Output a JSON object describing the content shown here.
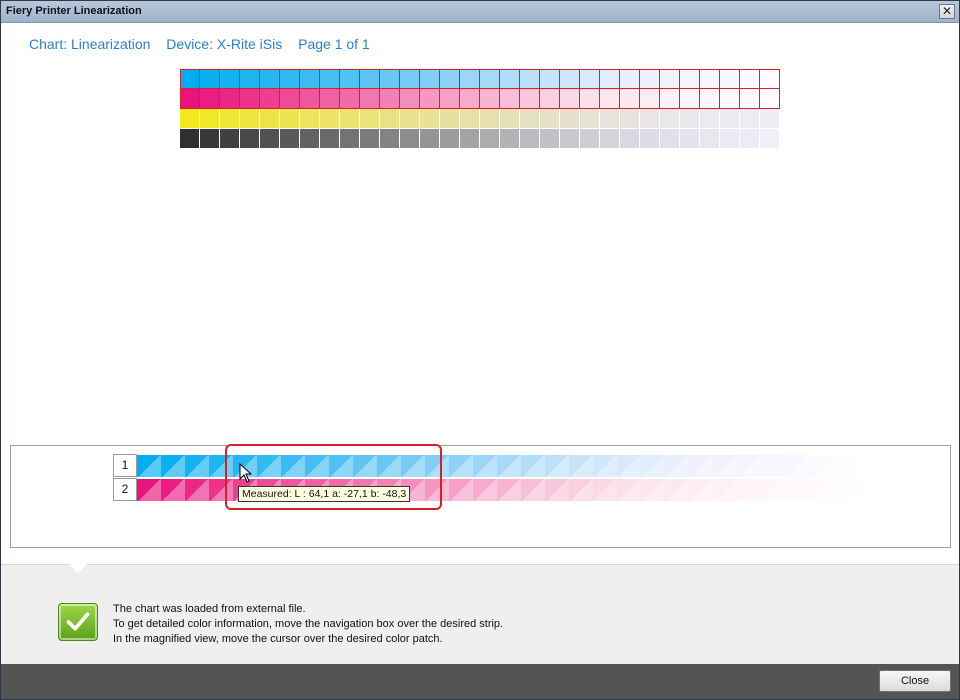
{
  "window": {
    "title": "Fiery Printer Linearization",
    "close_glyph": "✕"
  },
  "header": {
    "chart": "Chart: Linearization",
    "device": "Device: X-Rite iSis",
    "page": "Page 1 of 1"
  },
  "chart": {
    "rows": [
      {
        "name": "cyan",
        "colors": [
          "#00aeef",
          "#0bb0ef",
          "#14b2ef",
          "#1db4f0",
          "#27b6f0",
          "#31b9f1",
          "#3bbbf1",
          "#46bef2",
          "#52c1f3",
          "#5dc4f4",
          "#69c7f4",
          "#76cbf5",
          "#82cef6",
          "#8fd2f7",
          "#9bd5f7",
          "#a7d9f8",
          "#b2dcf9",
          "#bde0f9",
          "#c7e3fa",
          "#d0e6fb",
          "#d9e9fb",
          "#e1ecfc",
          "#e8eefc",
          "#eef0fd",
          "#f2f2fd",
          "#f5f4fd",
          "#f7f5fd",
          "#f9f7fe",
          "#fbf9fe",
          "#fcfbfe"
        ]
      },
      {
        "name": "magenta",
        "colors": [
          "#e8147d",
          "#e91d82",
          "#ea2887",
          "#eb338c",
          "#ec3f92",
          "#ed4a97",
          "#ee569d",
          "#ef61a3",
          "#f06ca9",
          "#f177af",
          "#f282b5",
          "#f38dbb",
          "#f497c1",
          "#f5a1c7",
          "#f6abcc",
          "#f7b5d1",
          "#f8bed6",
          "#f9c7db",
          "#fad0e0",
          "#fad8e5",
          "#fbdfe9",
          "#fce5ed",
          "#fce9f0",
          "#fdedf3",
          "#fdf0f6",
          "#fdf3f8",
          "#fef6fa",
          "#fef8fb",
          "#fefafc",
          "#fffcfd"
        ]
      },
      {
        "name": "yellow",
        "colors": [
          "#f2e81e",
          "#f1e72a",
          "#f0e635",
          "#efe53f",
          "#eee449",
          "#ede453",
          "#ede35d",
          "#ece367",
          "#ebe271",
          "#eae27b",
          "#e9e285",
          "#e9e18e",
          "#e8e197",
          "#e7e1a0",
          "#e7e1a9",
          "#e6e0b1",
          "#e6e0b9",
          "#e5e1c0",
          "#e5e1c7",
          "#e5e1ce",
          "#e6e2d4",
          "#e6e3da",
          "#e7e4df",
          "#e8e5e4",
          "#e9e7e8",
          "#eae8ec",
          "#ebeaef",
          "#ecebf2",
          "#edecf4",
          "#eeeef6"
        ]
      },
      {
        "name": "black",
        "colors": [
          "#2f2f2f",
          "#383838",
          "#404040",
          "#484848",
          "#515151",
          "#595959",
          "#626262",
          "#6a6a6a",
          "#737373",
          "#7b7b7b",
          "#838383",
          "#8c8c8c",
          "#949494",
          "#9c9c9c",
          "#a4a4a4",
          "#acacac",
          "#b3b3b6",
          "#babac0",
          "#c1c1c8",
          "#c7c7cf",
          "#cdcdd6",
          "#d3d3dc",
          "#d8d8e2",
          "#dcdce7",
          "#e0e0eb",
          "#e4e4ef",
          "#e7e7f2",
          "#eaeaf4",
          "#ececf6",
          "#efeff8"
        ]
      }
    ]
  },
  "magnified": {
    "strips": [
      {
        "number": "1",
        "colors": [
          "#00aeef",
          "#0bb0ef",
          "#14b2ef",
          "#1db4f0",
          "#27b6f0",
          "#31b9f1",
          "#3bbbf1",
          "#46bef2",
          "#52c1f3",
          "#5dc4f4",
          "#69c7f4",
          "#76cbf5",
          "#82cef6",
          "#8fd2f7",
          "#9bd5f7",
          "#a7d9f8",
          "#b2dcf9",
          "#bde0f9",
          "#c7e3fa",
          "#d0e6fb",
          "#d9e9fb",
          "#e1ecfc",
          "#e8eefc",
          "#eef0fd",
          "#f2f2fd",
          "#f5f4fd",
          "#f7f5fd",
          "#f9f7fe",
          "#fbf9fe",
          "#fcfbfe"
        ]
      },
      {
        "number": "2",
        "colors": [
          "#e8147d",
          "#e91d82",
          "#ea2887",
          "#eb338c",
          "#ec3f92",
          "#ed4a97",
          "#ee569d",
          "#ef61a3",
          "#f06ca9",
          "#f177af",
          "#f282b5",
          "#f38dbb",
          "#f497c1",
          "#f5a1c7",
          "#f6abcc",
          "#f7b5d1",
          "#f8bed6",
          "#f9c7db",
          "#fad0e0",
          "#fad8e5",
          "#fbdfe9",
          "#fce5ed",
          "#fce9f0",
          "#fdedf3",
          "#fdf0f6",
          "#fdf3f8",
          "#fef6fa",
          "#fef8fb",
          "#fefafc",
          "#fffcfd"
        ]
      }
    ],
    "tooltip": "Measured:  L : 64,1   a: -27,1   b: -48,3"
  },
  "message": {
    "line1": "The chart was loaded from external file.",
    "line2": "To get detailed color information, move the navigation box over the desired strip.",
    "line3": "In the magnified view, move the cursor over the desired color patch."
  },
  "footer": {
    "close_label": "Close"
  }
}
